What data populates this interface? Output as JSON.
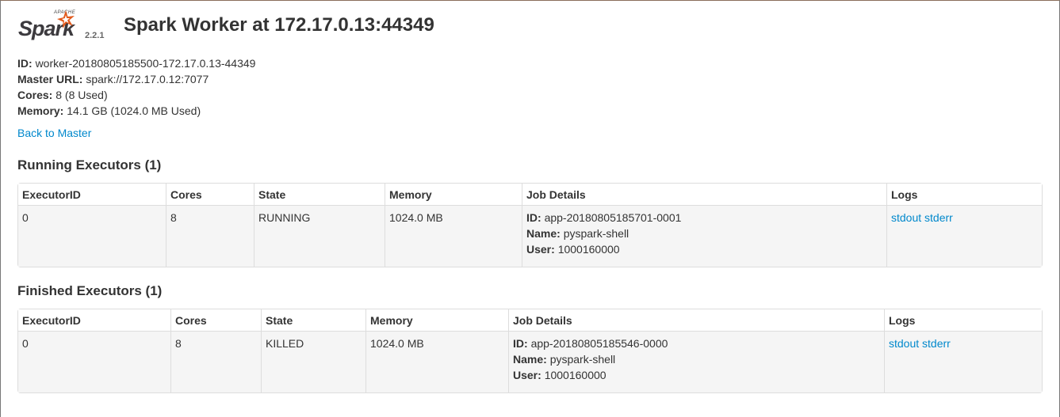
{
  "brand": {
    "apache": "APACHE",
    "name": "Spark",
    "version": "2.2.1",
    "accent": "#e25a1c"
  },
  "page_title": "Spark Worker at 172.17.0.13:44349",
  "info": {
    "id_label": "ID:",
    "id_value": "worker-20180805185500-172.17.0.13-44349",
    "master_label": "Master URL:",
    "master_value": "spark://172.17.0.12:7077",
    "cores_label": "Cores:",
    "cores_value": "8 (8 Used)",
    "memory_label": "Memory:",
    "memory_value": "14.1 GB (1024.0 MB Used)"
  },
  "back_link": "Back to Master",
  "running": {
    "heading": "Running Executors (1)",
    "columns": [
      "ExecutorID",
      "Cores",
      "State",
      "Memory",
      "Job Details",
      "Logs"
    ],
    "rows": [
      {
        "executor_id": "0",
        "cores": "8",
        "state": "RUNNING",
        "memory": "1024.0 MB",
        "id_label": "ID:",
        "id_value": "app-20180805185701-0001",
        "name_label": "Name:",
        "name_value": "pyspark-shell",
        "user_label": "User:",
        "user_value": "1000160000",
        "stdout": "stdout",
        "stderr": "stderr"
      }
    ]
  },
  "finished": {
    "heading": "Finished Executors (1)",
    "columns": [
      "ExecutorID",
      "Cores",
      "State",
      "Memory",
      "Job Details",
      "Logs"
    ],
    "rows": [
      {
        "executor_id": "0",
        "cores": "8",
        "state": "KILLED",
        "memory": "1024.0 MB",
        "id_label": "ID:",
        "id_value": "app-20180805185546-0000",
        "name_label": "Name:",
        "name_value": "pyspark-shell",
        "user_label": "User:",
        "user_value": "1000160000",
        "stdout": "stdout",
        "stderr": "stderr"
      }
    ]
  }
}
